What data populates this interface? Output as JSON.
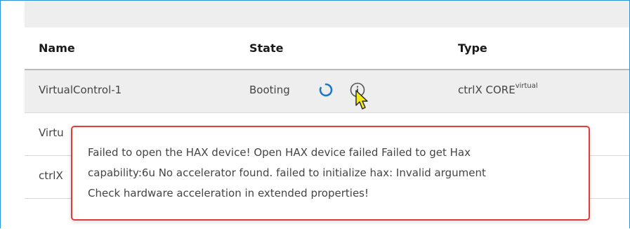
{
  "table": {
    "columns": [
      "Name",
      "State",
      "Type"
    ],
    "rows": [
      {
        "name": "VirtualControl-1",
        "state": "Booting",
        "type_main": "ctrlX CORE",
        "type_sup": "virtual",
        "selected": true
      },
      {
        "name": "Virtu",
        "state": "",
        "type_main": "",
        "type_sup": ""
      },
      {
        "name": "ctrlX",
        "state": "",
        "type_main": "",
        "type_sup": ""
      }
    ]
  },
  "icons": {
    "spinner": "loading-spinner-icon",
    "info": "info-icon",
    "cursor": "mouse-pointer-icon"
  },
  "colors": {
    "accent": "#1e77c8",
    "error_border": "#e53a3a",
    "frame_border": "#2d93d8",
    "cursor_fill": "#f5e81c"
  },
  "tooltip": {
    "lines": [
      "Failed to open the HAX device! Open HAX device failed Failed to get Hax",
      "capability:6u No accelerator found. failed to initialize hax: Invalid argument",
      "Check hardware acceleration in extended properties!"
    ]
  }
}
